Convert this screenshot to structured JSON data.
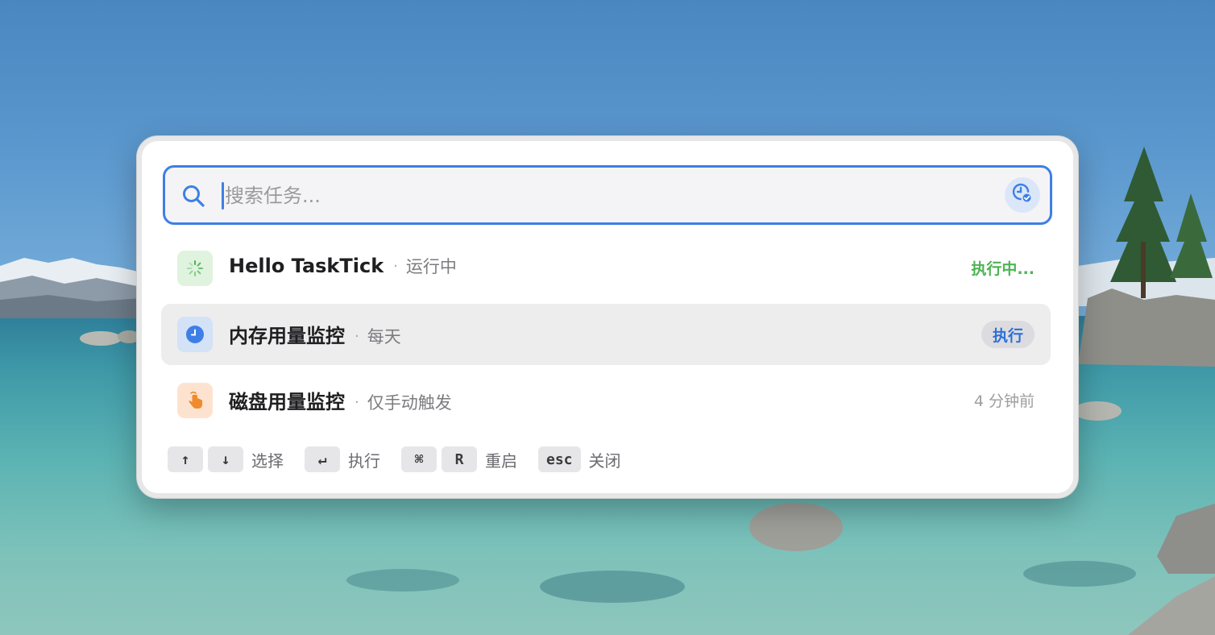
{
  "search": {
    "placeholder": "搜索任务...",
    "search_icon": "magnifier-icon",
    "history_icon": "clock-check-icon"
  },
  "tasks": [
    {
      "name": "Hello TaskTick",
      "schedule": "运行中",
      "status": "执行中...",
      "icon": "spinner-icon",
      "icon_color": "#4db453",
      "icon_bg": "#dff3df"
    },
    {
      "name": "内存用量监控",
      "schedule": "每天",
      "action": "执行",
      "icon": "clock-icon",
      "icon_color": "#3d7fe6",
      "icon_bg": "#d3e2f6",
      "selected": true
    },
    {
      "name": "磁盘用量监控",
      "schedule": "仅手动触发",
      "status": "4 分钟前",
      "icon": "hand-tap-icon",
      "icon_color": "#f08a2c",
      "icon_bg": "#fde3cf"
    }
  ],
  "separator": "·",
  "footer": {
    "select": {
      "keys": [
        "↑",
        "↓"
      ],
      "label": "选择"
    },
    "run": {
      "keys": [
        "↵"
      ],
      "label": "执行"
    },
    "restart": {
      "keys": [
        "⌘",
        "R"
      ],
      "label": "重启"
    },
    "close": {
      "keys": [
        "esc"
      ],
      "label": "关闭"
    }
  },
  "colors": {
    "accent": "#3d7fe6",
    "running": "#4db453",
    "selected_row": "#ededee"
  }
}
